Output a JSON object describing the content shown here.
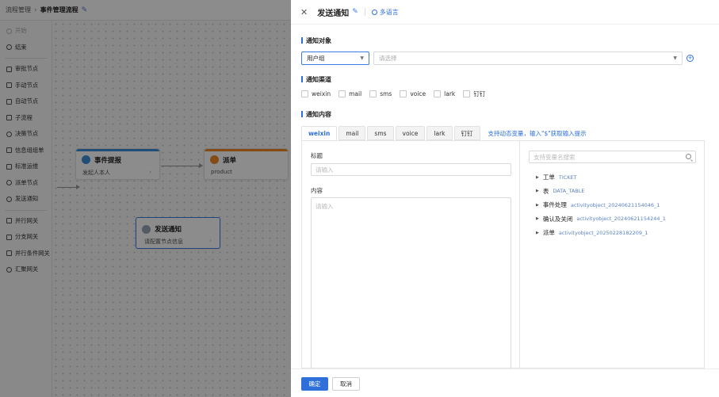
{
  "breadcrumb": {
    "root": "流程管理",
    "current": "事件管理流程"
  },
  "sidebar": {
    "items": [
      {
        "label": "开始",
        "disabled": true
      },
      {
        "label": "结束"
      },
      {
        "label": "审批节点"
      },
      {
        "label": "手动节点"
      },
      {
        "label": "自动节点"
      },
      {
        "label": "子流程"
      },
      {
        "label": "决策节点"
      },
      {
        "label": "信息组组单"
      },
      {
        "label": "标准运维"
      },
      {
        "label": "派单节点"
      },
      {
        "label": "发送通知"
      },
      {
        "label": "并行网关"
      },
      {
        "label": "分支网关"
      },
      {
        "label": "并行条件网关"
      },
      {
        "label": "汇聚网关"
      }
    ]
  },
  "canvas": {
    "nodes": [
      {
        "title": "事件提报",
        "subtitle": "发起人本人",
        "color": "#3b8fd9"
      },
      {
        "title": "派单",
        "subtitle": "product",
        "color": "#f08a24"
      },
      {
        "title": "发送通知",
        "subtitle": "请配置节点信息",
        "color": "#3b7ce0"
      }
    ]
  },
  "drawer": {
    "title": "发送通知",
    "multilang_label": "多语言",
    "recipients": {
      "section_title": "通知对象",
      "type_value": "用户组",
      "select_placeholder": "请选择"
    },
    "channels": {
      "section_title": "通知渠道",
      "options": [
        "weixin",
        "mail",
        "sms",
        "voice",
        "lark",
        "钉钉"
      ]
    },
    "content": {
      "section_title": "通知内容",
      "tabs": [
        "weixin",
        "mail",
        "sms",
        "voice",
        "lark",
        "钉钉"
      ],
      "active_tab": "weixin",
      "hint": "支持动态变量，输入\"$\"获取输入提示",
      "title_label": "标题",
      "title_placeholder": "请输入",
      "body_label": "内容",
      "body_placeholder": "请输入",
      "search_placeholder": "支持变量名搜索",
      "variables": [
        {
          "name": "工单",
          "code": "TICKET"
        },
        {
          "name": "表",
          "code": "DATA_TABLE"
        },
        {
          "name": "事件处理",
          "code": "activityobject_20240621154046_1"
        },
        {
          "name": "确认及关闭",
          "code": "activityobject_20240621154244_1"
        },
        {
          "name": "派单",
          "code": "activityobject_20250228182209_1"
        }
      ]
    },
    "footer": {
      "confirm_label": "确定",
      "cancel_label": "取消"
    }
  },
  "colors": {
    "accent": "#2e6fd9"
  }
}
